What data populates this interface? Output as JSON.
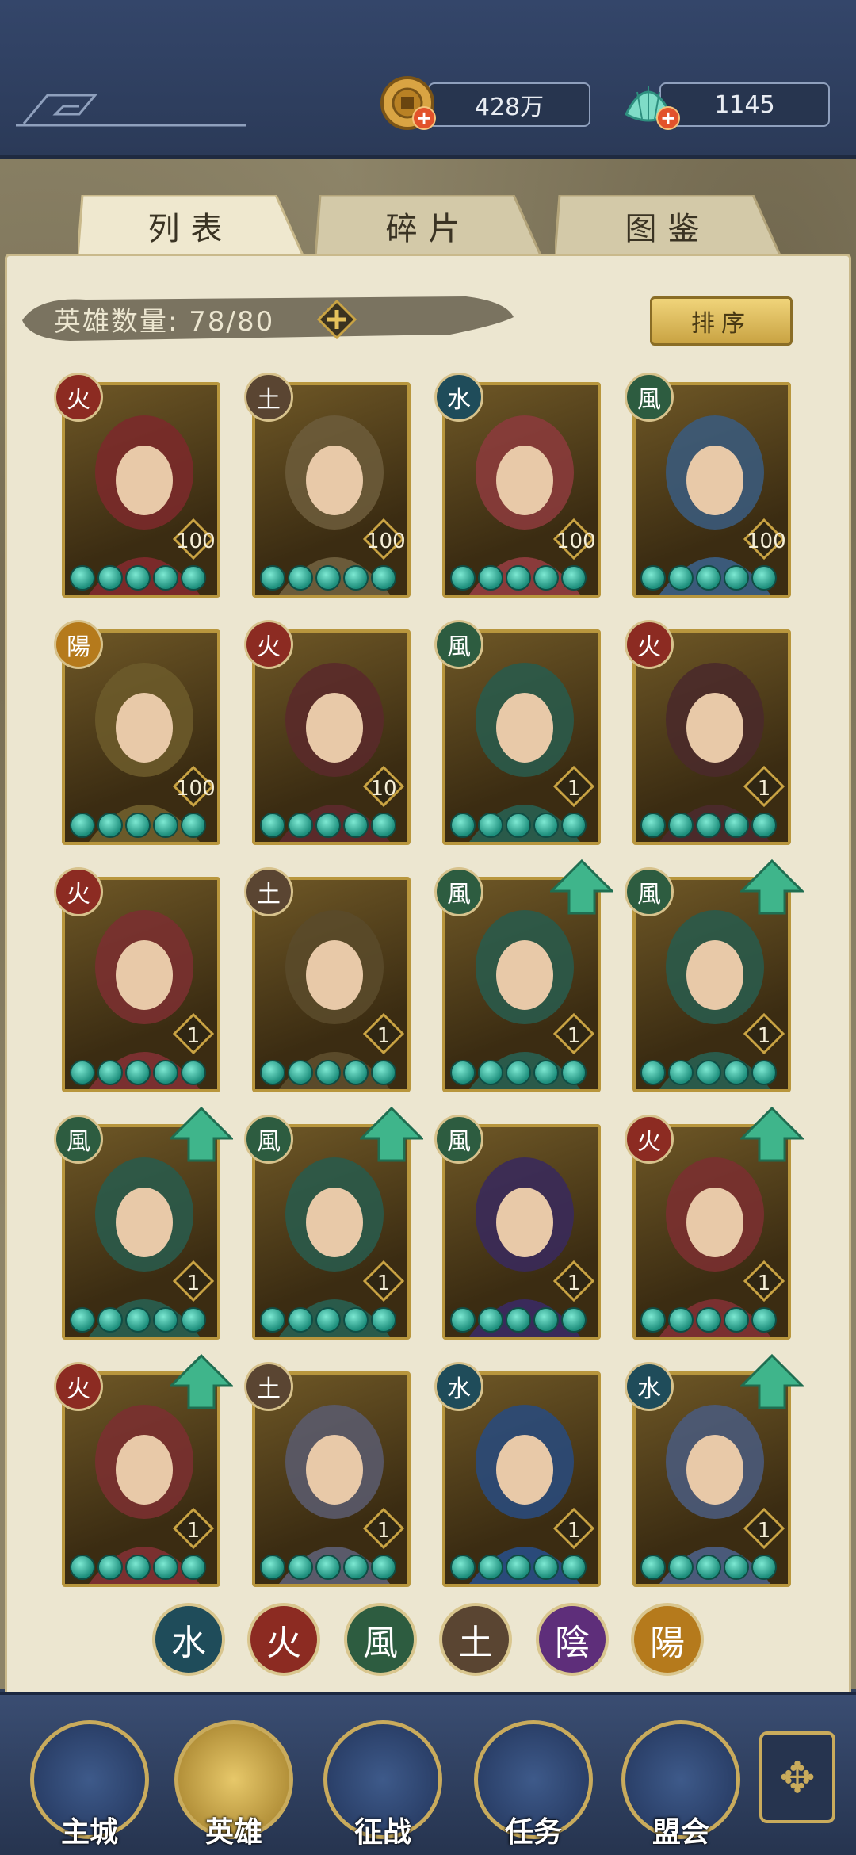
{
  "currency": {
    "coins": "428万",
    "jade": "1145"
  },
  "tabs": [
    {
      "label": "列表",
      "active": true
    },
    {
      "label": "碎片",
      "active": false
    },
    {
      "label": "图鉴",
      "active": false
    }
  ],
  "hero_count": {
    "text": "英雄数量: 78/80"
  },
  "sort_label": "排序",
  "heroes": [
    {
      "element": "火",
      "level": "100"
    },
    {
      "element": "土",
      "level": "100"
    },
    {
      "element": "水",
      "level": "100"
    },
    {
      "element": "風",
      "level": "100"
    },
    {
      "element": "陽",
      "level": "100"
    },
    {
      "element": "火",
      "level": "10"
    },
    {
      "element": "風",
      "level": "1"
    },
    {
      "element": "火",
      "level": "1"
    },
    {
      "element": "火",
      "level": "1"
    },
    {
      "element": "土",
      "level": "1"
    },
    {
      "element": "風",
      "level": "1",
      "upgrade": true
    },
    {
      "element": "風",
      "level": "1",
      "upgrade": true
    },
    {
      "element": "風",
      "level": "1",
      "upgrade": true
    },
    {
      "element": "風",
      "level": "1",
      "upgrade": true
    },
    {
      "element": "風",
      "level": "1"
    },
    {
      "element": "火",
      "level": "1",
      "upgrade": true
    },
    {
      "element": "火",
      "level": "1",
      "upgrade": true
    },
    {
      "element": "土",
      "level": "1"
    },
    {
      "element": "水",
      "level": "1"
    },
    {
      "element": "水",
      "level": "1",
      "upgrade": true
    }
  ],
  "filters": [
    {
      "glyph": "水",
      "color": "#1f4c5a"
    },
    {
      "glyph": "火",
      "color": "#8c2b22"
    },
    {
      "glyph": "風",
      "color": "#2d5c40"
    },
    {
      "glyph": "土",
      "color": "#5a4532"
    },
    {
      "glyph": "陰",
      "color": "#5e2e7a"
    },
    {
      "glyph": "陽",
      "color": "#b57a1c"
    }
  ],
  "nav": [
    {
      "label": "主城",
      "active": false
    },
    {
      "label": "英雄",
      "active": true
    },
    {
      "label": "征战",
      "active": false
    },
    {
      "label": "任务",
      "active": false
    },
    {
      "label": "盟会",
      "active": false
    }
  ]
}
